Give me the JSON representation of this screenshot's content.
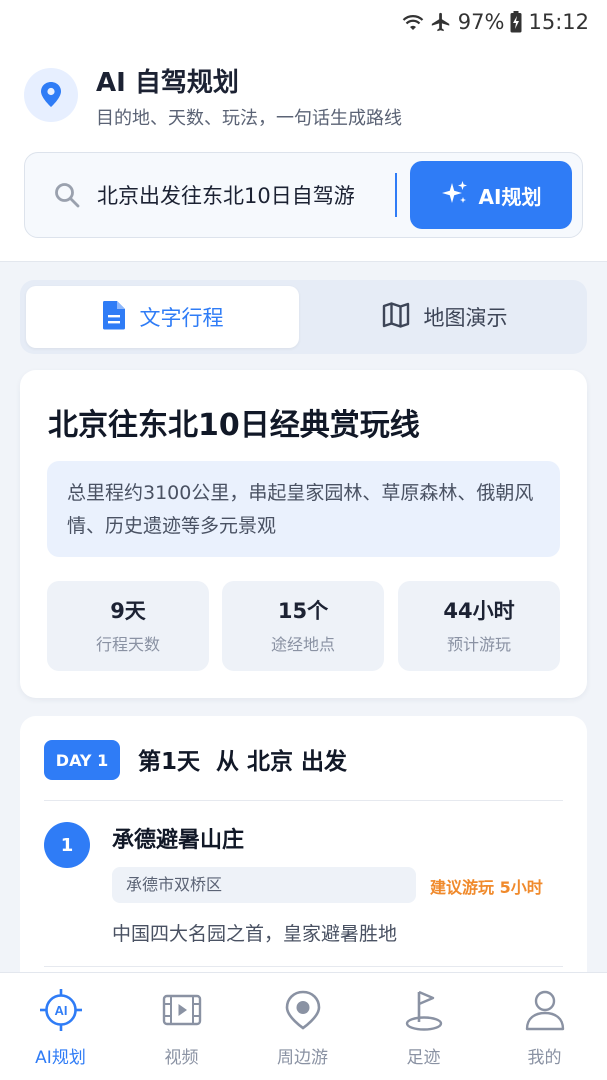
{
  "status_bar": {
    "battery": "97%",
    "time": "15:12"
  },
  "header": {
    "title": "AI 自驾规划",
    "subtitle": "目的地、天数、玩法，一句话生成路线"
  },
  "search": {
    "value": "北京出发往东北10日自驾游",
    "button_label": "AI规划"
  },
  "tabs": [
    {
      "label": "文字行程",
      "active": true
    },
    {
      "label": "地图演示",
      "active": false
    }
  ],
  "summary": {
    "title": "北京往东北10日经典赏玩线",
    "description": "总里程约3100公里，串起皇家园林、草原森林、俄朝风情、历史遗迹等多元景观",
    "stats": [
      {
        "value": "9天",
        "label": "行程天数"
      },
      {
        "value": "15个",
        "label": "途经地点"
      },
      {
        "value": "44小时",
        "label": "预计游玩"
      }
    ]
  },
  "day": {
    "badge": "DAY 1",
    "title": "第1天  从 北京 出发",
    "stops": [
      {
        "number": "1",
        "name": "承德避暑山庄",
        "location": "承德市双桥区",
        "duration": "建议游玩 5小时",
        "description": "中国四大名园之首，皇家避暑胜地"
      }
    ]
  },
  "bottom_nav": [
    {
      "label": "AI规划",
      "icon": "ai-icon",
      "active": true
    },
    {
      "label": "视频",
      "icon": "video-icon",
      "active": false
    },
    {
      "label": "周边游",
      "icon": "location-icon",
      "active": false
    },
    {
      "label": "足迹",
      "icon": "flag-icon",
      "active": false
    },
    {
      "label": "我的",
      "icon": "user-icon",
      "active": false
    }
  ],
  "colors": {
    "accent": "#2f7cf6",
    "warning": "#f08a2c",
    "background": "#f1f4f9"
  }
}
